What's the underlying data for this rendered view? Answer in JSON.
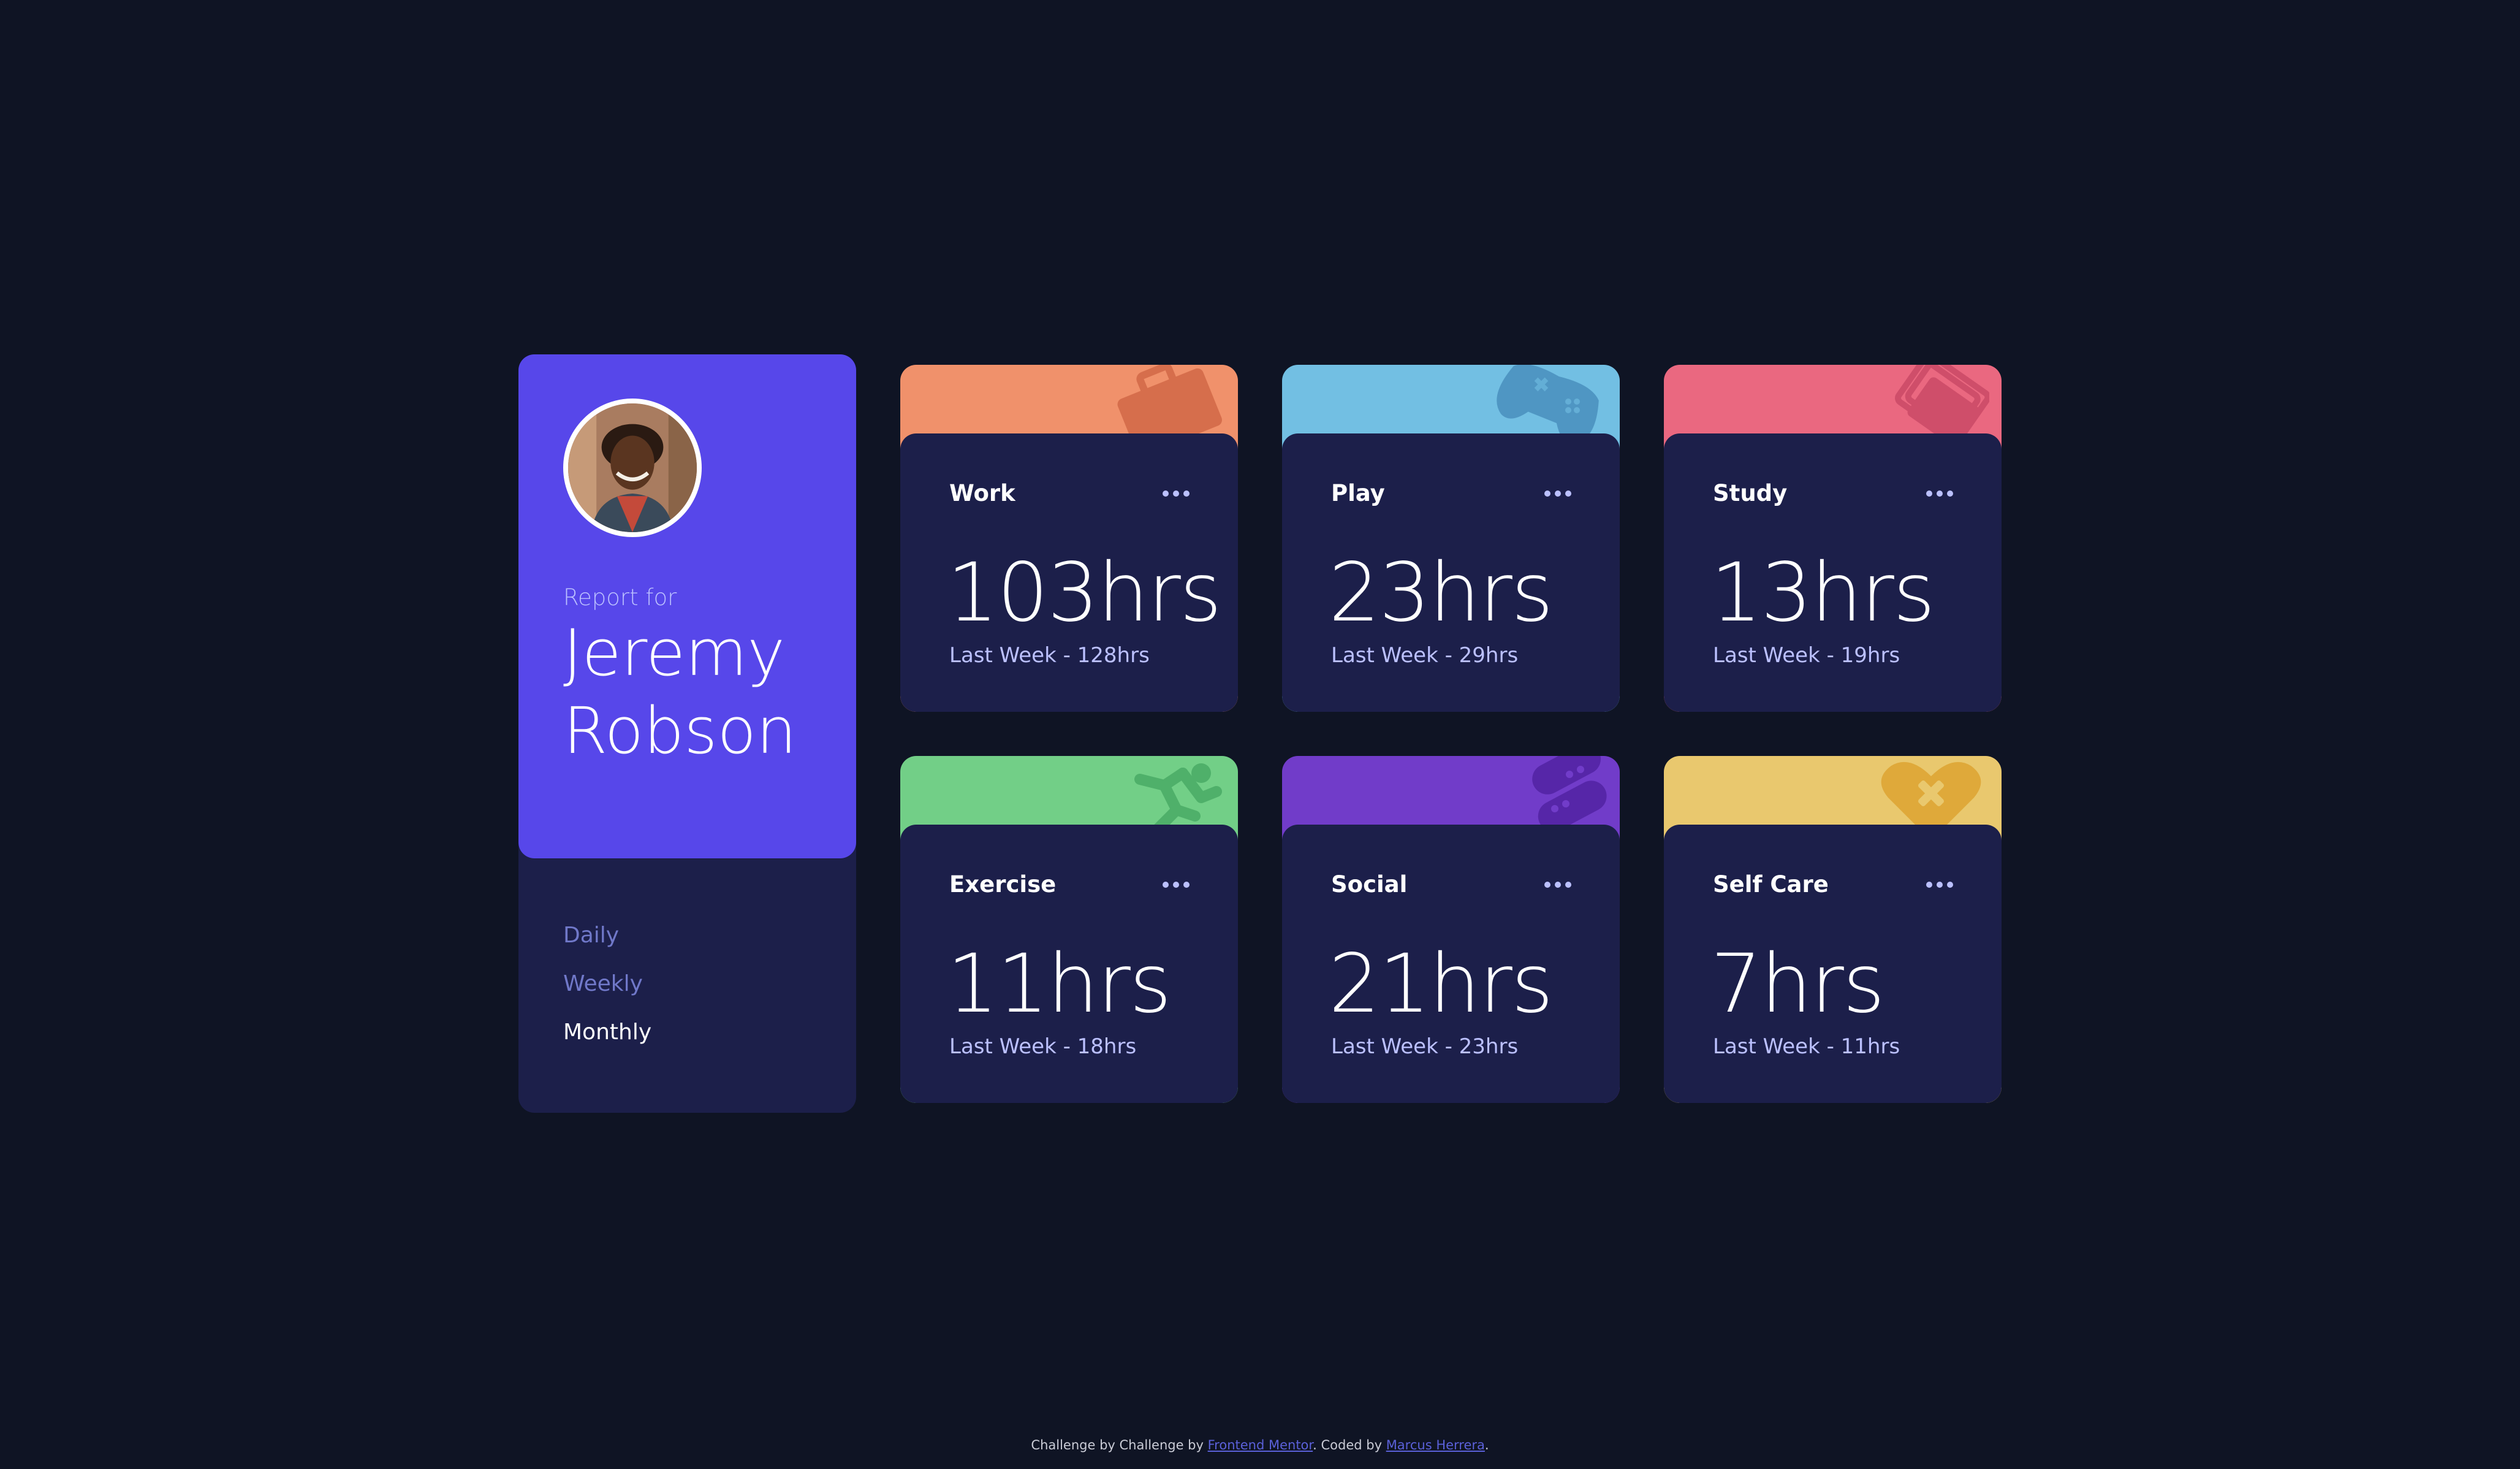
{
  "profile": {
    "report_for": "Report for",
    "name": "Jeremy Robson",
    "avatar_alt": "avatar"
  },
  "timeframes": [
    {
      "label": "Daily",
      "active": false
    },
    {
      "label": "Weekly",
      "active": false
    },
    {
      "label": "Monthly",
      "active": true
    }
  ],
  "cards": [
    {
      "title": "Work",
      "hours": "103hrs",
      "previous": "Last Week - 128hrs",
      "color": "#f0916b",
      "icon": "briefcase-icon"
    },
    {
      "title": "Play",
      "hours": "23hrs",
      "previous": "Last Week - 29hrs",
      "color": "#72bfe3",
      "icon": "gamepad-icon"
    },
    {
      "title": "Study",
      "hours": "13hrs",
      "previous": "Last Week - 19hrs",
      "color": "#ea6880",
      "icon": "books-icon"
    },
    {
      "title": "Exercise",
      "hours": "11hrs",
      "previous": "Last Week - 18hrs",
      "color": "#72cf87",
      "icon": "runner-icon"
    },
    {
      "title": "Social",
      "hours": "21hrs",
      "previous": "Last Week - 23hrs",
      "color": "#713cc9",
      "icon": "chat-bubbles-icon"
    },
    {
      "title": "Self Care",
      "hours": "7hrs",
      "previous": "Last Week - 11hrs",
      "color": "#e9c86e",
      "icon": "heart-plus-icon"
    }
  ],
  "colors": {
    "background": "#0f1424",
    "card": "#1c1f4a",
    "accent": "#5747ea",
    "muted": "#7078c9",
    "pale": "#bbc0ff"
  },
  "footer": {
    "prefix": "Challenge by Challenge by ",
    "link1": "Frontend Mentor",
    "middle": ". Coded by ",
    "link2": "Marcus Herrera",
    "suffix": "."
  }
}
